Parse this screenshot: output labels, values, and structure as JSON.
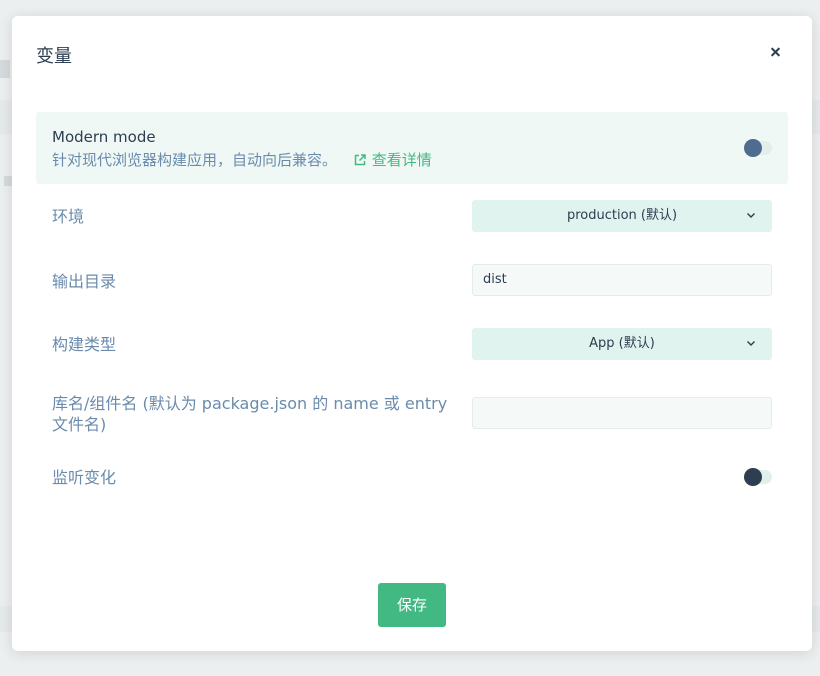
{
  "modal": {
    "title": "变量",
    "close_icon": "close-icon"
  },
  "modern_mode": {
    "label": "Modern mode",
    "description": "针对现代浏览器构建应用，自动向后兼容。",
    "link_icon": "external-link-icon",
    "link_text": "查看详情",
    "enabled": false
  },
  "fields": {
    "environment": {
      "label": "环境",
      "value": "production (默认)",
      "icon": "chevron-down-icon"
    },
    "output_dir": {
      "label": "输出目录",
      "value": "dist"
    },
    "build_type": {
      "label": "构建类型",
      "value": "App (默认)",
      "icon": "chevron-down-icon"
    },
    "lib_name": {
      "label": "库名/组件名 (默认为 package.json 的 name 或 entry 文件名)",
      "value": ""
    },
    "watch": {
      "label": "监听变化",
      "enabled": false
    }
  },
  "actions": {
    "save_label": "保存"
  },
  "colors": {
    "accent": "#42b983",
    "text_dark": "#2c3e50",
    "text_muted": "#6a8bad",
    "toggle_knob_modern": "#4f6b8f",
    "toggle_knob_watch": "#2c3e50"
  }
}
